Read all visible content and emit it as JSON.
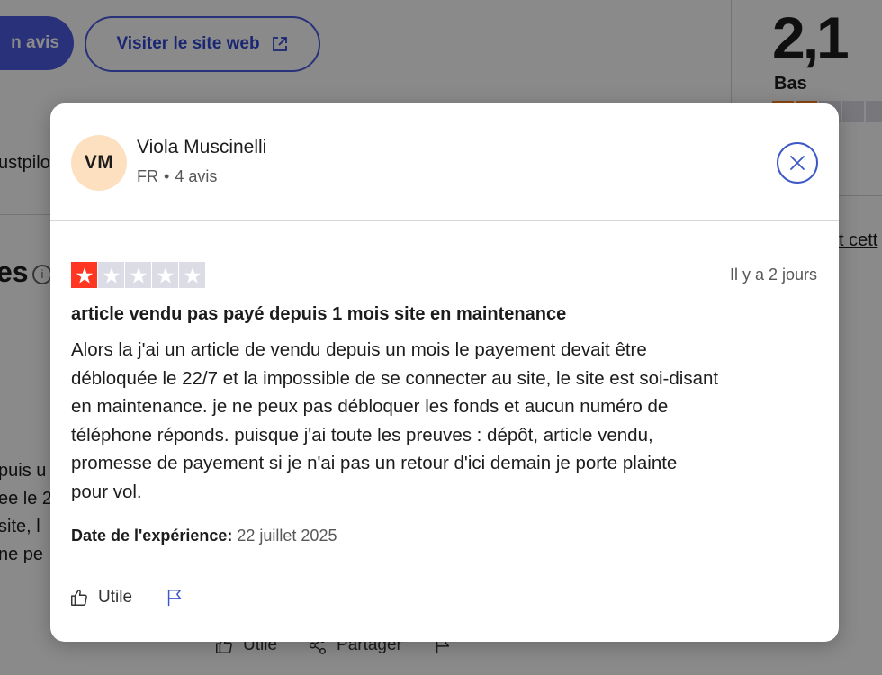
{
  "background": {
    "primary_button_label": "n avis",
    "visit_button_label": "Visiter le site web",
    "score": "2,1",
    "score_label": "Bas",
    "score_stars_filled": 2,
    "score_stars_total": 5,
    "side_fragment": "ustpilo",
    "section_title_fragment": "es",
    "link_fragment": "t cett",
    "body_fragments": [
      "puis u",
      "ee le 2",
      "site, l",
      "ne pe"
    ],
    "actions": {
      "useful": "Utile",
      "share": "Partager"
    }
  },
  "modal": {
    "reviewer": {
      "initials": "VM",
      "name": "Viola Muscinelli",
      "country": "FR",
      "separator": "•",
      "review_count": "4 avis"
    },
    "review": {
      "rating": 1,
      "rating_max": 5,
      "date": "Il y a 2 jours",
      "title": "article vendu pas payé depuis 1 mois site en maintenance",
      "body_lines": [
        "Alors la j'ai un article de vendu depuis un mois le payement devait être",
        "débloquée le 22/7 et la impossible de se connecter au site, le site est soi-disant",
        "en maintenance. je ne peux pas débloquer les fonds et aucun numéro de",
        "téléphone réponds. puisque j'ai toute les preuves : dépôt, article vendu,",
        "promesse de payement si je n'ai pas un retour d'ici demain je porte plainte",
        "pour vol."
      ],
      "experience_label": "Date de l'expérience:",
      "experience_date": "22 juillet 2025"
    },
    "actions": {
      "useful": "Utile"
    },
    "icons": [
      "close-icon",
      "star-icon",
      "thumbs-up-icon",
      "flag-icon"
    ],
    "colors": {
      "star_on": "#ff3722",
      "star_off": "#dcdce6",
      "accent": "#3c57c9",
      "avatar_bg": "#fde0bf"
    }
  }
}
